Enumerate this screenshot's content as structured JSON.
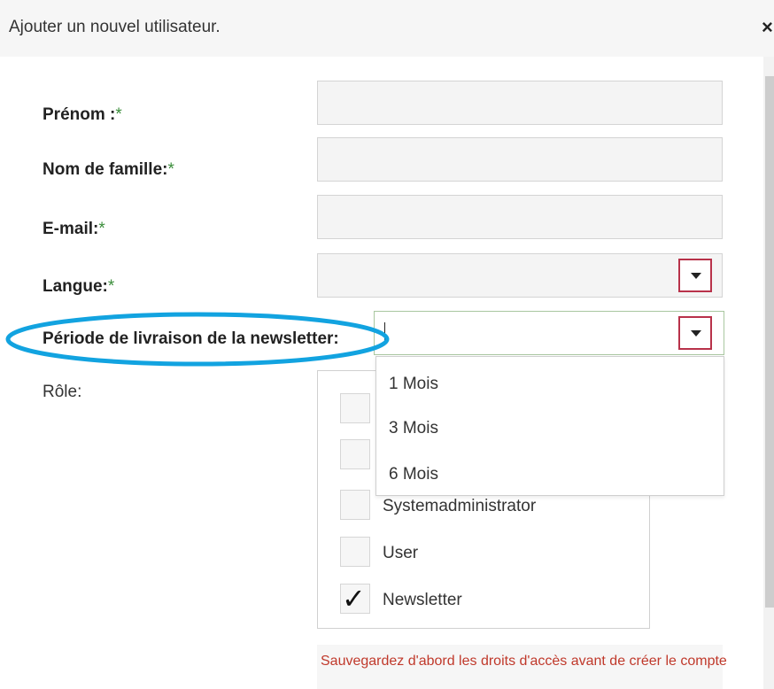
{
  "dialog": {
    "title": "Ajouter un nouvel utilisateur.",
    "close_label": "×"
  },
  "form": {
    "required_mark": "*",
    "first_name_label": "Prénom :",
    "last_name_label": "Nom de famille:",
    "email_label": "E-mail:",
    "language_label": "Langue:",
    "newsletter_period_label": "Période de livraison de la newsletter:",
    "role_label": "Rôle:"
  },
  "newsletter_period_options": [
    "1 Mois",
    "3 Mois",
    "6 Mois"
  ],
  "roles": [
    {
      "label": "",
      "checked": false
    },
    {
      "label": "",
      "checked": false
    },
    {
      "label": "Systemadministrator",
      "checked": false
    },
    {
      "label": "User",
      "checked": false
    },
    {
      "label": "Newsletter",
      "checked": true
    }
  ],
  "notice": "Sauvegardez d'abord les droits d'accès avant de créer le compte",
  "colors": {
    "required_mark": "#3b8e3b",
    "select_button_border": "#b8324a",
    "highlight_ellipse": "#12a3e0",
    "notice_text": "#c0392b"
  }
}
